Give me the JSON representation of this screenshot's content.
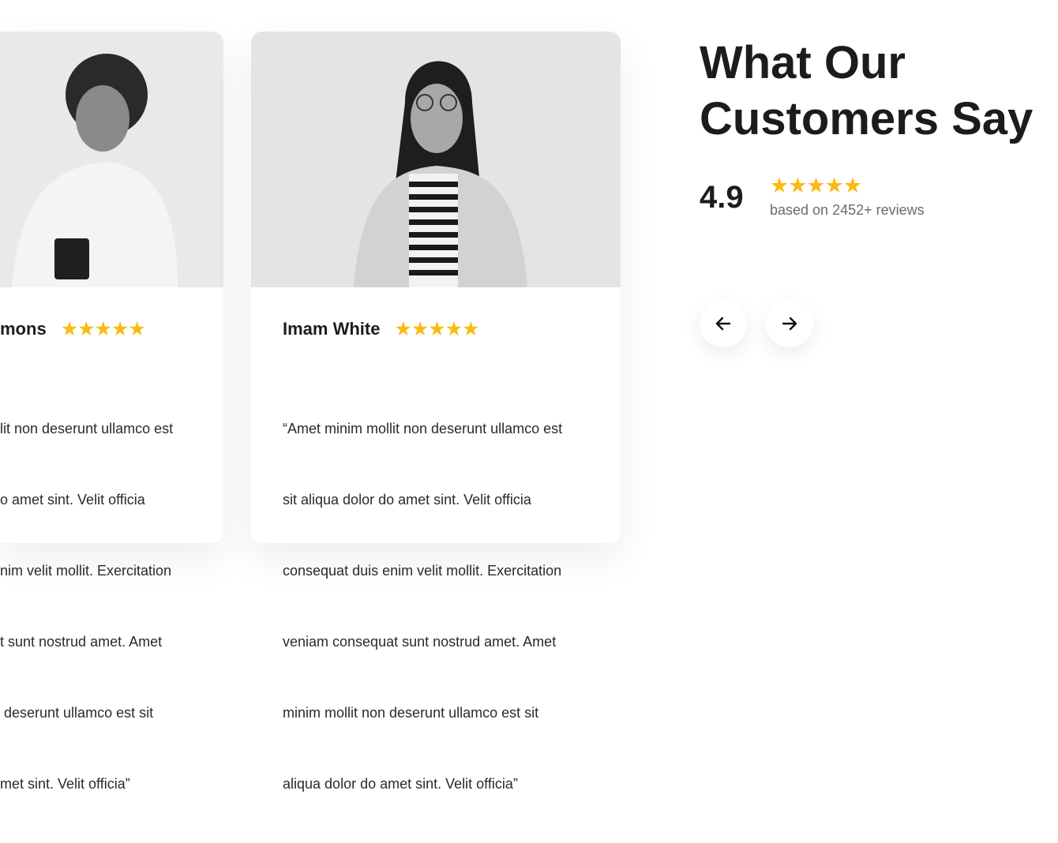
{
  "heading": {
    "line1": "What Our",
    "line2": "Customers Say"
  },
  "rating": {
    "score": "4.9",
    "stars": "★★★★★",
    "based_on": "based on 2452+ reviews",
    "value": 4.9
  },
  "colors": {
    "star": "#fdb913",
    "text": "#1c1c1c"
  },
  "testimonials": [
    {
      "name": "mons",
      "stars": "★★★★★",
      "quote_lines": [
        "lit non deserunt ullamco est",
        "o amet sint. Velit officia",
        "nim velit mollit. Exercitation",
        "t sunt nostrud amet. Amet",
        " deserunt ullamco est sit",
        "met sint. Velit officia”"
      ]
    },
    {
      "name": "Imam White",
      "stars": "★★★★★",
      "quote_lines": [
        "“Amet minim mollit non deserunt ullamco est",
        "sit aliqua dolor do amet sint. Velit officia",
        "consequat duis enim velit mollit. Exercitation",
        "veniam consequat sunt nostrud amet. Amet",
        "minim mollit non deserunt ullamco est sit",
        "aliqua dolor do amet sint. Velit officia”"
      ]
    }
  ],
  "nav": {
    "prev_icon": "arrow-left-icon",
    "next_icon": "arrow-right-icon"
  }
}
